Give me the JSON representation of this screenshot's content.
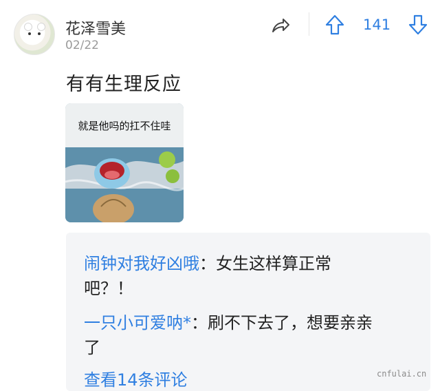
{
  "header": {
    "username": "花泽雪美",
    "date": "02/22",
    "vote_count": "141"
  },
  "post": {
    "text": "有有生理反应",
    "meme_caption": "就是他吗的扛不住哇"
  },
  "comments": [
    {
      "name": "闹钟对我好凶哦",
      "text_line1": "：女生这样算正常",
      "text_line2": "吧？！"
    },
    {
      "name": "一只小可爱呐*",
      "text_line1": "：刷不下去了，想要亲亲",
      "text_line2": "了"
    }
  ],
  "more_comments": "查看14条评论",
  "watermark": "cnfulai.cn",
  "icons": [
    "share-icon",
    "upvote-arrow-icon",
    "downvote-arrow-icon"
  ],
  "colors": {
    "accent": "#2f7fe1",
    "comment_bg": "#f4f5f7"
  }
}
